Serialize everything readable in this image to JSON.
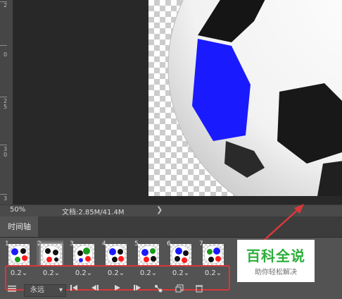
{
  "ruler": {
    "labels": [
      "2",
      "0",
      "2",
      "5",
      "3",
      "0",
      "3"
    ]
  },
  "status": {
    "zoom": "50%",
    "doc": "文档:2.85M/41.4M",
    "arrow": "❯"
  },
  "panel": {
    "tab": "时间轴"
  },
  "frames": [
    {
      "num": "1",
      "delay": "0.2"
    },
    {
      "num": "2",
      "delay": "0.2"
    },
    {
      "num": "3",
      "delay": "0.2"
    },
    {
      "num": "4",
      "delay": "0.2"
    },
    {
      "num": "5",
      "delay": "0.2"
    },
    {
      "num": "6",
      "delay": "0.2"
    },
    {
      "num": "7",
      "delay": "0.2"
    }
  ],
  "toolbar": {
    "loop_label": "永远",
    "menu_icon": "menu-lines-icon",
    "first_icon": "first-frame-icon",
    "prev_icon": "previous-frame-icon",
    "play_icon": "play-icon",
    "next_icon": "next-frame-icon",
    "tween_icon": "tween-icon",
    "duplicate_icon": "duplicate-frame-icon",
    "delete_icon": "trash-icon"
  },
  "watermark": {
    "title": "百科全说",
    "subtitle": "助你轻松解决"
  },
  "colors": {
    "highlight": "#d9383a",
    "ball_blue": "#1a1aff",
    "ball_red": "#ff1a1a",
    "watermark_green": "#2cae3b"
  }
}
